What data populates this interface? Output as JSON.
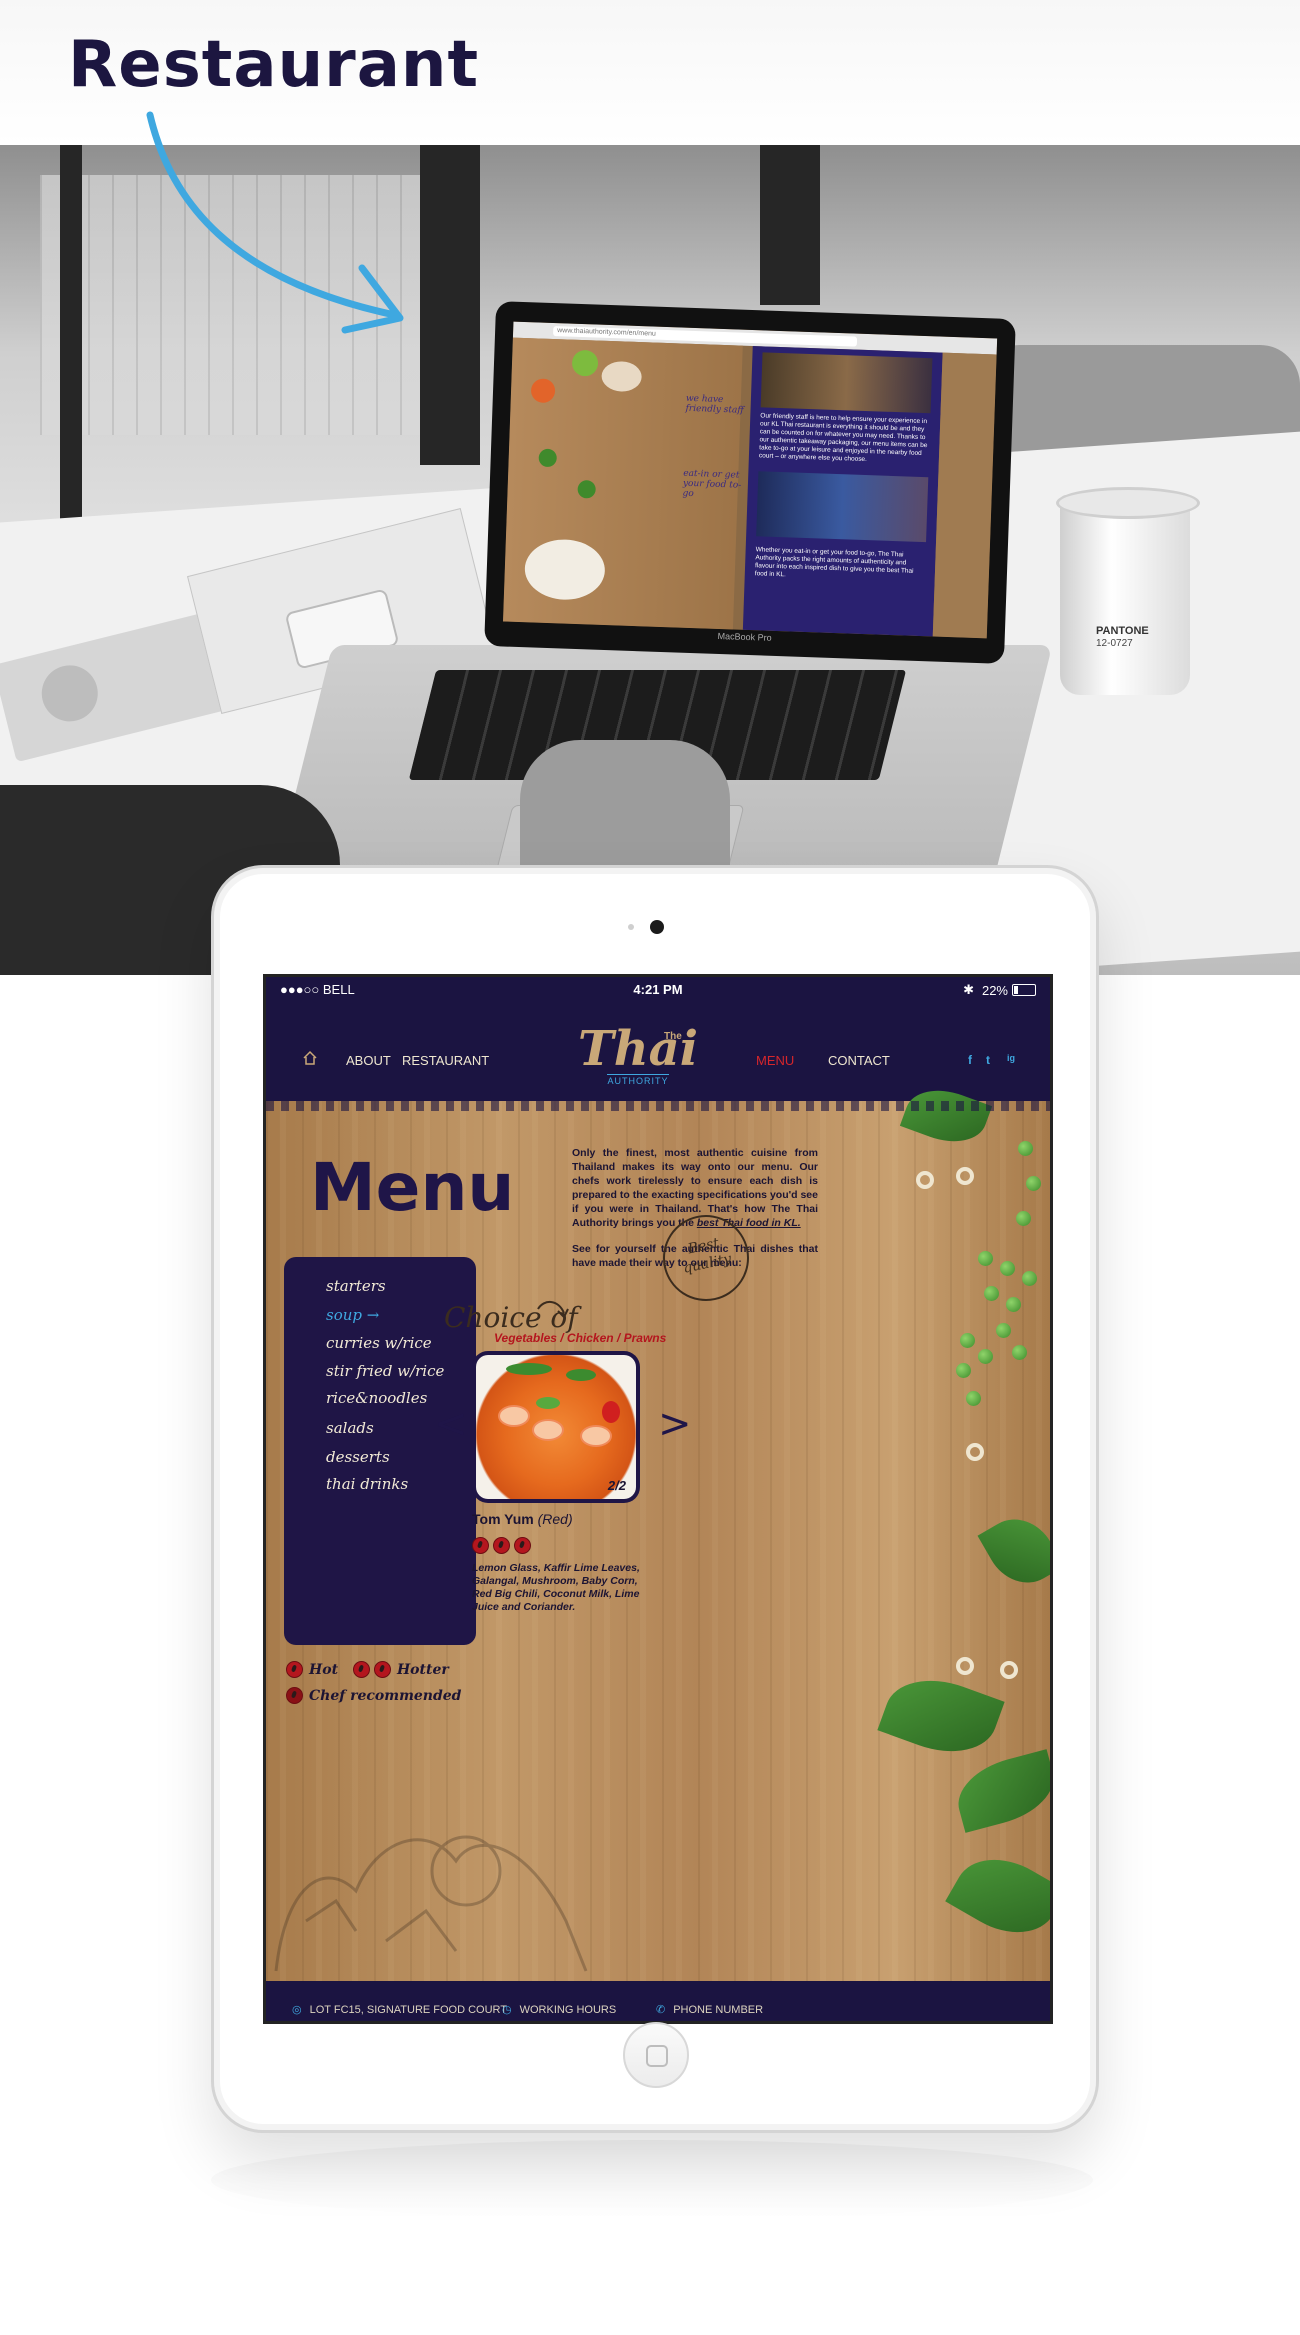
{
  "page": {
    "title": "Restaurant"
  },
  "laptop": {
    "brand": "MacBook Pro",
    "url": "www.thaiauthority.com/en/menu",
    "note1": "we have friendly staff",
    "note2": "eat-in or get your food to-go",
    "text1": "Our friendly staff is here to help ensure your experience in our KL Thai restaurant is everything it should be and they can be counted on for whatever you may need. Thanks to our authentic takeaway packaging, our menu items can be take to-go at your leisure and enjoyed in the nearby food court – or anywhere else you choose.",
    "text2": "Whether you eat-in or get your food to-go, The Thai Authority packs the right amounts of authenticity and flavour into each inspired dish to give you the best Thai food in KL."
  },
  "mug": {
    "brand": "PANTONE",
    "code": "12-0727"
  },
  "ipad": {
    "status": {
      "carrier": "●●●○○ BELL",
      "time": "4:21 PM",
      "battery": "22%",
      "battery_level": 0.22
    },
    "nav": {
      "home_icon": "home-icon",
      "links": [
        "ABOUT",
        "RESTAURANT",
        "MENU",
        "CONTACT"
      ],
      "active": "MENU",
      "active_color": "#d6262b",
      "social": [
        "f",
        "t",
        "ig"
      ]
    },
    "logo": {
      "the": "The",
      "word": "Thai",
      "sub": "AUTHORITY"
    },
    "menu": {
      "title": "Menu",
      "intro_p1_a": "Only the finest, most authentic cuisine from Thailand makes its way onto our menu. Our chefs work tirelessly to ensure each dish is prepared to the exacting specifications you'd see if you were in Thailand. That's how The Thai Authority brings you the ",
      "intro_p1_link": "best Thai food in KL.",
      "intro_p2": "See for yourself the authentic Thai dishes that have made their way to our menu:",
      "categories": [
        "starters",
        "soup",
        "curries w/rice",
        "stir fried w/rice",
        "rice&noodles",
        "salads",
        "desserts",
        "thai drinks"
      ],
      "active_category": "soup",
      "active_arrow": "→",
      "legend": {
        "hot": "Hot",
        "hotter": "Hotter",
        "chef": "Chef recommended"
      },
      "choice_of": "Choice of",
      "protein": "Vegetables / Chicken / Prawns",
      "best_quality": "Best quality",
      "slide": "2/2",
      "prev": "<",
      "next": ">",
      "dish": {
        "name": "Tom Yum",
        "variant": "(Red)",
        "heat": 3,
        "ingredients": "Lemon Glass, Kaffir Lime Leaves, Galangal, Mushroom, Baby Corn, Red Big Chili, Coconut Milk, Lime Juice and Coriander."
      }
    },
    "footer": {
      "address": "Lot FC15, Signature Food Court",
      "hours": "WORKING HOURS",
      "phone": "PHONE NUMBER"
    }
  }
}
